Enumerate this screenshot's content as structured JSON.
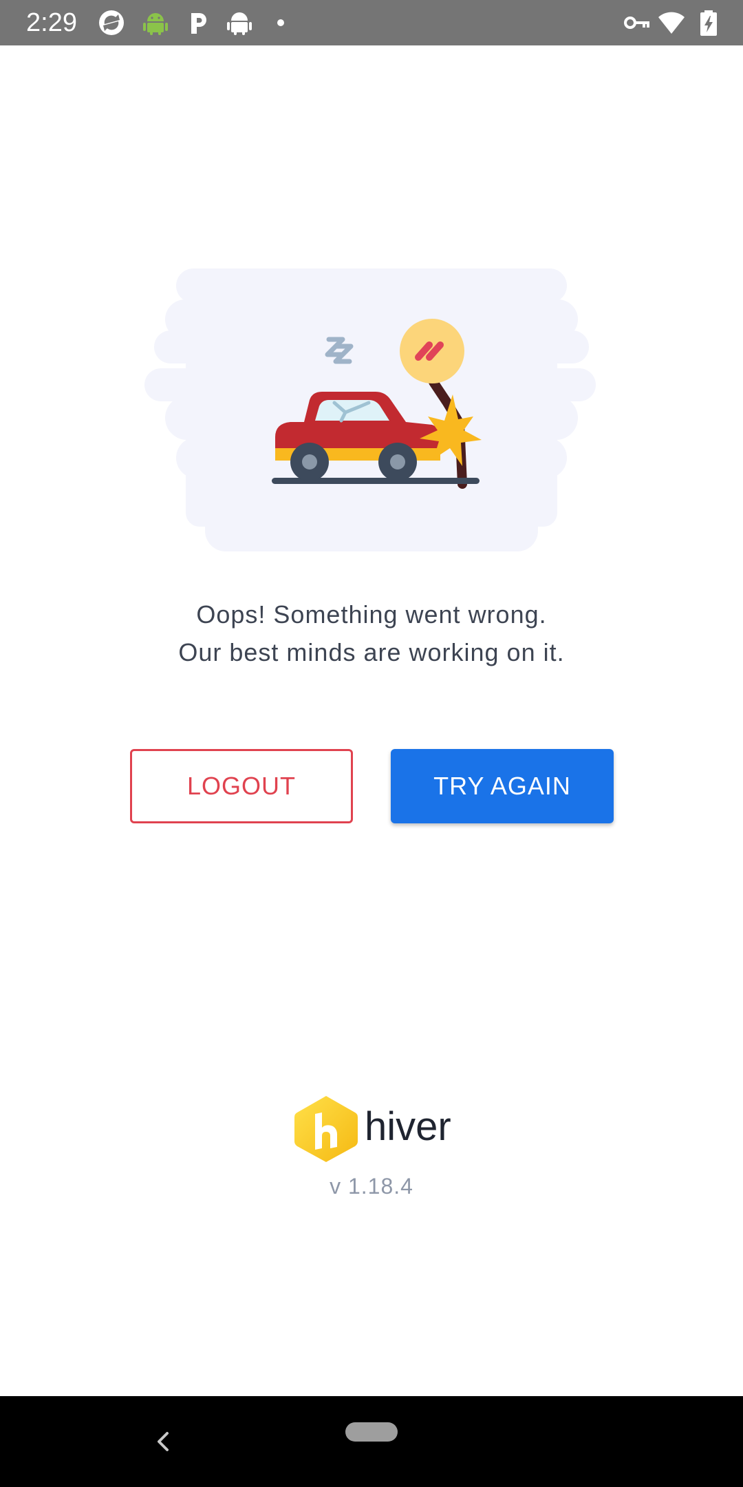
{
  "status_bar": {
    "time": "2:29",
    "left_icons": [
      "sync-icon",
      "android-icon",
      "parking-p-icon",
      "android-robot-icon",
      "dot-icon"
    ],
    "right_icons": [
      "vpn-key-icon",
      "wifi-icon",
      "battery-charging-icon"
    ]
  },
  "illustration": {
    "name": "car-crash-illustration",
    "colors": {
      "background": "#f3f4fc",
      "car_body": "#c8232d",
      "car_stripe": "#f9b81f",
      "wheel": "#3d4a5c",
      "sign": "#fcd57a",
      "post": "#4a1d1d",
      "burst": "#f9b81f"
    }
  },
  "message": {
    "line1": "Oops! Something went wrong.",
    "line2": "Our best minds are working on it."
  },
  "buttons": {
    "logout_label": "LOGOUT",
    "retry_label": "TRY AGAIN"
  },
  "brand": {
    "name": "hiver",
    "logo_icon": "hiver-logo-icon",
    "version": "v 1.18.4"
  },
  "nav": {
    "back_icon": "back-chevron-icon",
    "home_icon": "home-pill-icon"
  },
  "colors": {
    "accent_blue": "#1a73e8",
    "accent_red": "#e0424f",
    "status_bar": "#757575"
  }
}
